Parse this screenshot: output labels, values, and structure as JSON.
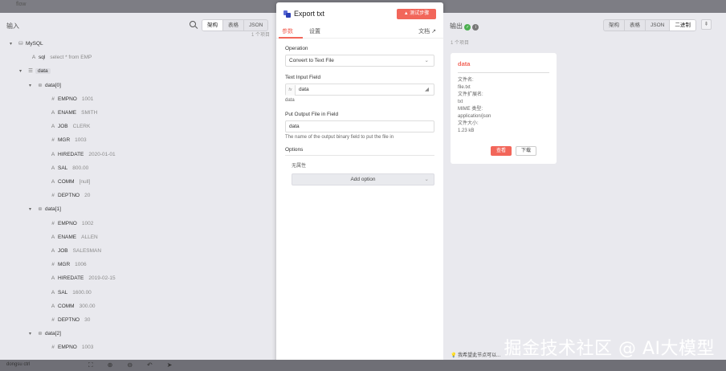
{
  "topbar": {
    "label": "flow"
  },
  "input": {
    "title": "输入",
    "views": [
      "架构",
      "表格",
      "JSON"
    ],
    "active_view": "架构",
    "count": "1 个项目"
  },
  "tree": [
    {
      "indent": 0,
      "chev": "▾",
      "icon": "db-icon",
      "glyph": "⛁",
      "key": "MySQL",
      "val": ""
    },
    {
      "indent": 1,
      "chev": "",
      "icon": "string-type-icon",
      "glyph": "A",
      "key": "sql",
      "val": "select * from EMP"
    },
    {
      "indent": 1,
      "chev": "▾",
      "icon": "list-icon",
      "glyph": "☰",
      "key": "data",
      "val": "",
      "tag": true
    },
    {
      "indent": 2,
      "chev": "▾",
      "icon": "object-icon",
      "glyph": "⊜",
      "key": "data[0]",
      "val": ""
    },
    {
      "indent": 3,
      "chev": "",
      "icon": "number-type-icon",
      "glyph": "#",
      "key": "EMPNO",
      "val": "1001"
    },
    {
      "indent": 3,
      "chev": "",
      "icon": "string-type-icon",
      "glyph": "A",
      "key": "ENAME",
      "val": "SMITH"
    },
    {
      "indent": 3,
      "chev": "",
      "icon": "string-type-icon",
      "glyph": "A",
      "key": "JOB",
      "val": "CLERK"
    },
    {
      "indent": 3,
      "chev": "",
      "icon": "number-type-icon",
      "glyph": "#",
      "key": "MGR",
      "val": "1003"
    },
    {
      "indent": 3,
      "chev": "",
      "icon": "string-type-icon",
      "glyph": "A",
      "key": "HIREDATE",
      "val": "2020-01-01"
    },
    {
      "indent": 3,
      "chev": "",
      "icon": "string-type-icon",
      "glyph": "A",
      "key": "SAL",
      "val": "800.00"
    },
    {
      "indent": 3,
      "chev": "",
      "icon": "string-type-icon",
      "glyph": "A",
      "key": "COMM",
      "val": "[null]"
    },
    {
      "indent": 3,
      "chev": "",
      "icon": "number-type-icon",
      "glyph": "#",
      "key": "DEPTNO",
      "val": "20"
    },
    {
      "indent": 2,
      "chev": "▾",
      "icon": "object-icon",
      "glyph": "⊜",
      "key": "data[1]",
      "val": ""
    },
    {
      "indent": 3,
      "chev": "",
      "icon": "number-type-icon",
      "glyph": "#",
      "key": "EMPNO",
      "val": "1002"
    },
    {
      "indent": 3,
      "chev": "",
      "icon": "string-type-icon",
      "glyph": "A",
      "key": "ENAME",
      "val": "ALLEN"
    },
    {
      "indent": 3,
      "chev": "",
      "icon": "string-type-icon",
      "glyph": "A",
      "key": "JOB",
      "val": "SALESMAN"
    },
    {
      "indent": 3,
      "chev": "",
      "icon": "number-type-icon",
      "glyph": "#",
      "key": "MGR",
      "val": "1006"
    },
    {
      "indent": 3,
      "chev": "",
      "icon": "string-type-icon",
      "glyph": "A",
      "key": "HIREDATE",
      "val": "2019-02-15"
    },
    {
      "indent": 3,
      "chev": "",
      "icon": "string-type-icon",
      "glyph": "A",
      "key": "SAL",
      "val": "1600.00"
    },
    {
      "indent": 3,
      "chev": "",
      "icon": "string-type-icon",
      "glyph": "A",
      "key": "COMM",
      "val": "300.00"
    },
    {
      "indent": 3,
      "chev": "",
      "icon": "number-type-icon",
      "glyph": "#",
      "key": "DEPTNO",
      "val": "30"
    },
    {
      "indent": 2,
      "chev": "▾",
      "icon": "object-icon",
      "glyph": "⊜",
      "key": "data[2]",
      "val": ""
    },
    {
      "indent": 3,
      "chev": "",
      "icon": "number-type-icon",
      "glyph": "#",
      "key": "EMPNO",
      "val": "1003"
    }
  ],
  "modal": {
    "title": "Export txt",
    "test_button": "测试步骤",
    "tabs": [
      "参数",
      "设置"
    ],
    "docs": "文档",
    "operation_label": "Operation",
    "operation_value": "Convert to Text File",
    "text_input_label": "Text Input Field",
    "text_input_value": "data",
    "text_input_hint": "data",
    "put_output_label": "Put Output File in Field",
    "put_output_value": "data",
    "put_output_hint": "The name of the output binary field to put the file in",
    "options_label": "Options",
    "no_props": "无属性",
    "add_option": "Add option"
  },
  "output": {
    "title": "输出",
    "views": [
      "架构",
      "表格",
      "JSON",
      "二进制"
    ],
    "active_view": "二进制",
    "count": "1 个项目",
    "card_title": "data",
    "file_info": [
      "文件名:",
      "file.txt",
      "文件扩展名:",
      "txt",
      "MIME 类型:",
      "application/json",
      "文件大小:",
      "1.23 kB"
    ],
    "view_button": "查看",
    "download_button": "下载",
    "tip": "我希望此节点可以..."
  },
  "bottombar": {
    "label": "dongsu ctrl"
  },
  "watermark": "掘金技术社区 @ AI大模型",
  "colors": {
    "accent": "#f2665a",
    "success": "#4caf50",
    "node": "#2b3fb6"
  }
}
